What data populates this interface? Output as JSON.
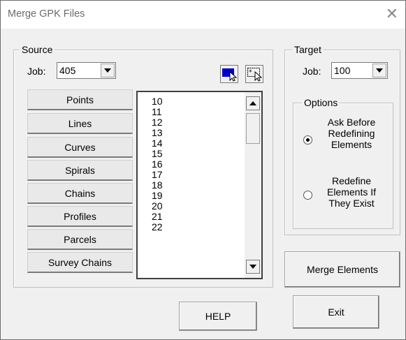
{
  "window": {
    "title": "Merge GPK Files",
    "close_glyph": "✕"
  },
  "source": {
    "legend": "Source",
    "job_label": "Job:",
    "job_value": "405",
    "buttons": [
      "Points",
      "Lines",
      "Curves",
      "Spirals",
      "Chains",
      "Profiles",
      "Parcels",
      "Survey Chains"
    ],
    "list_items": [
      "10",
      "11",
      "12",
      "13",
      "14",
      "15",
      "16",
      "17",
      "18",
      "19",
      "20",
      "21",
      "22"
    ],
    "tool_icons": [
      "select-all-icon",
      "select-pattern-icon"
    ],
    "tool_select_all_color": "#0000c8"
  },
  "target": {
    "legend": "Target",
    "job_label": "Job:",
    "job_value": "100"
  },
  "options": {
    "legend": "Options",
    "ask_before_redefining": [
      "Ask Before",
      "Redefining",
      "Elements"
    ],
    "redefine_if_exist": [
      "Redefine",
      "Elements If",
      "They Exist"
    ],
    "selected": "ask_before_redefining"
  },
  "buttons": {
    "merge": "Merge Elements",
    "help": "HELP",
    "exit": "Exit"
  }
}
